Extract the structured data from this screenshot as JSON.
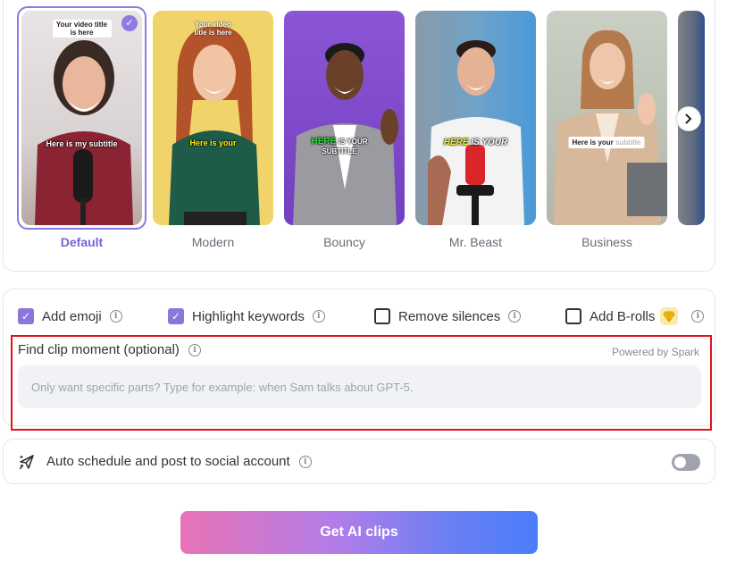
{
  "templates": [
    {
      "name": "Default",
      "selected": true,
      "caption_title": "Your video title is here",
      "caption_subtitle": "Here is my subtitle"
    },
    {
      "name": "Modern",
      "selected": false,
      "caption_title": "Your video title is here",
      "caption_subtitle": "Here is your"
    },
    {
      "name": "Bouncy",
      "selected": false,
      "caption_word1": "HERE",
      "caption_word2": "IS YOUR",
      "caption_word3": "SUBTITLE"
    },
    {
      "name": "Mr. Beast",
      "selected": false,
      "caption_word1": "HERE",
      "caption_word2": "IS YOUR"
    },
    {
      "name": "Business",
      "selected": false,
      "caption_word1": "Here is your",
      "caption_word2": "subtitle"
    }
  ],
  "options": {
    "add_emoji": {
      "label": "Add emoji",
      "checked": true
    },
    "highlight_keywords": {
      "label": "Highlight keywords",
      "checked": true
    },
    "remove_silences": {
      "label": "Remove silences",
      "checked": false
    },
    "add_brolls": {
      "label": "Add B-rolls",
      "checked": false
    }
  },
  "find_clip": {
    "label": "Find clip moment (optional)",
    "powered_by": "Powered by Spark",
    "placeholder": "Only want specific parts? Type for example: when Sam talks about GPT-5."
  },
  "schedule": {
    "label": "Auto schedule and post to social account",
    "enabled": false
  },
  "cta": {
    "label": "Get AI clips"
  },
  "colors": {
    "accent": "#8b76dc",
    "highlight_box": "#e0141c",
    "cta_start": "#e873b6",
    "cta_end": "#4a7dfb"
  }
}
